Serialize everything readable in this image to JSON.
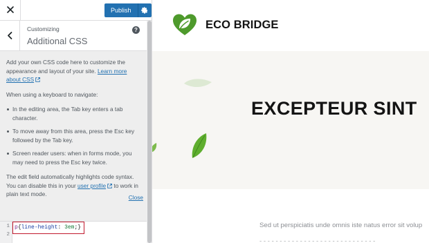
{
  "topbar": {
    "close_icon": "close-icon",
    "publish_label": "Publish",
    "publish_settings_icon": "gear-icon"
  },
  "section": {
    "back_icon": "chevron-left-icon",
    "customizing_label": "Customizing",
    "title": "Additional CSS",
    "help_icon": "question-circle-icon"
  },
  "description": {
    "intro": "Add your own CSS code here to customize the appearance and layout of your site.",
    "learn_more_link": "Learn more about CSS",
    "keyboard_heading": "When using a keyboard to navigate:",
    "bullets": [
      "In the editing area, the Tab key enters a tab character.",
      "To move away from this area, press the Esc key followed by the Tab key.",
      "Screen reader users: when in forms mode, you may need to press the Esc key twice."
    ],
    "highlight_text_before": "The edit field automatically highlights code syntax. You can disable this in your",
    "user_profile_link": "user profile",
    "highlight_text_after": "to work in plain text mode.",
    "close_link": "Close"
  },
  "code_editor": {
    "line_numbers": [
      "1",
      "2"
    ],
    "selector": "p",
    "open_brace": "{",
    "property": "line-height",
    "colon": ":",
    "value": "3em",
    "close": ";}"
  },
  "preview": {
    "site_title": "ECO BRIDGE",
    "logo_icon": "leaf-heart-logo-icon",
    "hero_title": "EXCEPTEUR SINT",
    "body_text": "Sed ut perspiciatis unde omnis iste natus error sit volup",
    "body_text_2": "- - - - - - - - - - - - - - - - - - - - - - - - - - - - -"
  },
  "colors": {
    "accent": "#2271b1",
    "highlight_box": "#c0182c",
    "leaf_green": "#4e9a2c"
  }
}
